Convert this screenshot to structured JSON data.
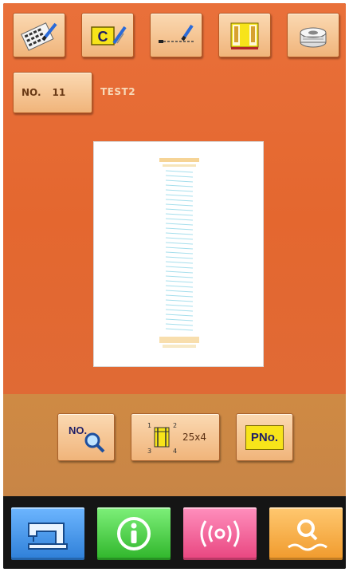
{
  "toolbar": {
    "icons": [
      "pattern-edit-icon",
      "copy-c-icon",
      "sewing-path-icon",
      "folder-window-icon",
      "bobbin-icon"
    ]
  },
  "pattern": {
    "number_label": "NO.",
    "number_value": "11",
    "name": "TEST2"
  },
  "actions": {
    "search_label": "NO.",
    "scale_value": "25x4",
    "scale_markers": [
      "1",
      "2",
      "3",
      "4"
    ],
    "pno_label": "PNo."
  },
  "nav": {
    "icons": [
      "sewing-machine-icon",
      "info-icon",
      "communication-icon",
      "mode-search-icon"
    ]
  },
  "colors": {
    "background_orange": "#e4672f",
    "lower_panel": "#c88546",
    "button_face": "#f0b47a",
    "nav_blue": "#3b8fe0",
    "nav_green": "#3ec43a",
    "nav_pink": "#f0609a",
    "nav_orange": "#f4a23a",
    "badge_yellow": "#f7e41a"
  }
}
